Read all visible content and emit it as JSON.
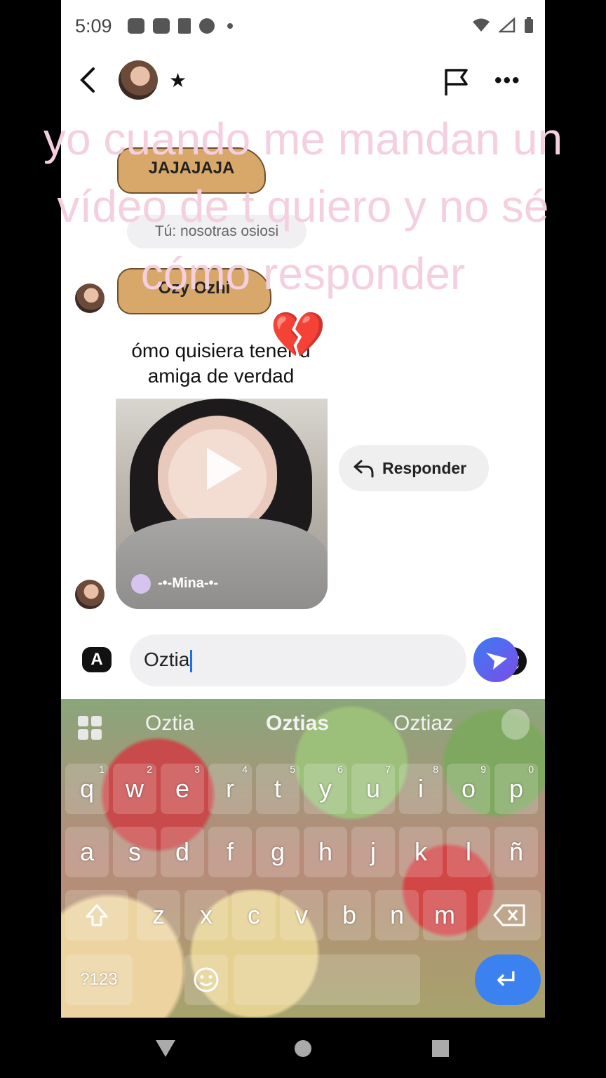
{
  "status_bar": {
    "time": "5:09",
    "left_icons": [
      "chat-icon",
      "youtube-icon",
      "tiktok-icon",
      "pinterest-icon",
      "dot-icon"
    ],
    "right_icons": [
      "wifi-icon",
      "signal-icon",
      "battery-icon"
    ]
  },
  "header": {
    "star": "★",
    "more": "•••"
  },
  "chat": {
    "sticker_top": "JAJAJAJA",
    "reply_preview": "Tú: nosotras osiosi",
    "sticker_bottom": "Ozy Ozhi",
    "caption": "ómo quisiera tener u amiga de verdad",
    "heart": "💔",
    "video_user": "-•-Mina-•-",
    "responder_label": "Responder"
  },
  "overlay_text": "yo cuando me mandan un vídeo de t quiero y no sé cómo responder",
  "composer": {
    "a_label": "A",
    "input_value": "Oztia"
  },
  "keyboard": {
    "suggestions": [
      "Oztia",
      "Oztias",
      "Oztiaz"
    ],
    "row1": [
      "q",
      "w",
      "e",
      "r",
      "t",
      "y",
      "u",
      "i",
      "o",
      "p"
    ],
    "row1_nums": [
      "1",
      "2",
      "3",
      "4",
      "5",
      "6",
      "7",
      "8",
      "9",
      "0"
    ],
    "row2": [
      "a",
      "s",
      "d",
      "f",
      "g",
      "h",
      "j",
      "k",
      "l",
      "ñ"
    ],
    "row3": [
      "z",
      "x",
      "c",
      "v",
      "b",
      "n",
      "m"
    ],
    "symbols_label": "?123",
    "enter_symbol": "↵"
  },
  "colors": {
    "overlay_pink": "#f4cfe0",
    "send_blue": "#3d7bf2",
    "enter_blue": "#3b82f0"
  }
}
